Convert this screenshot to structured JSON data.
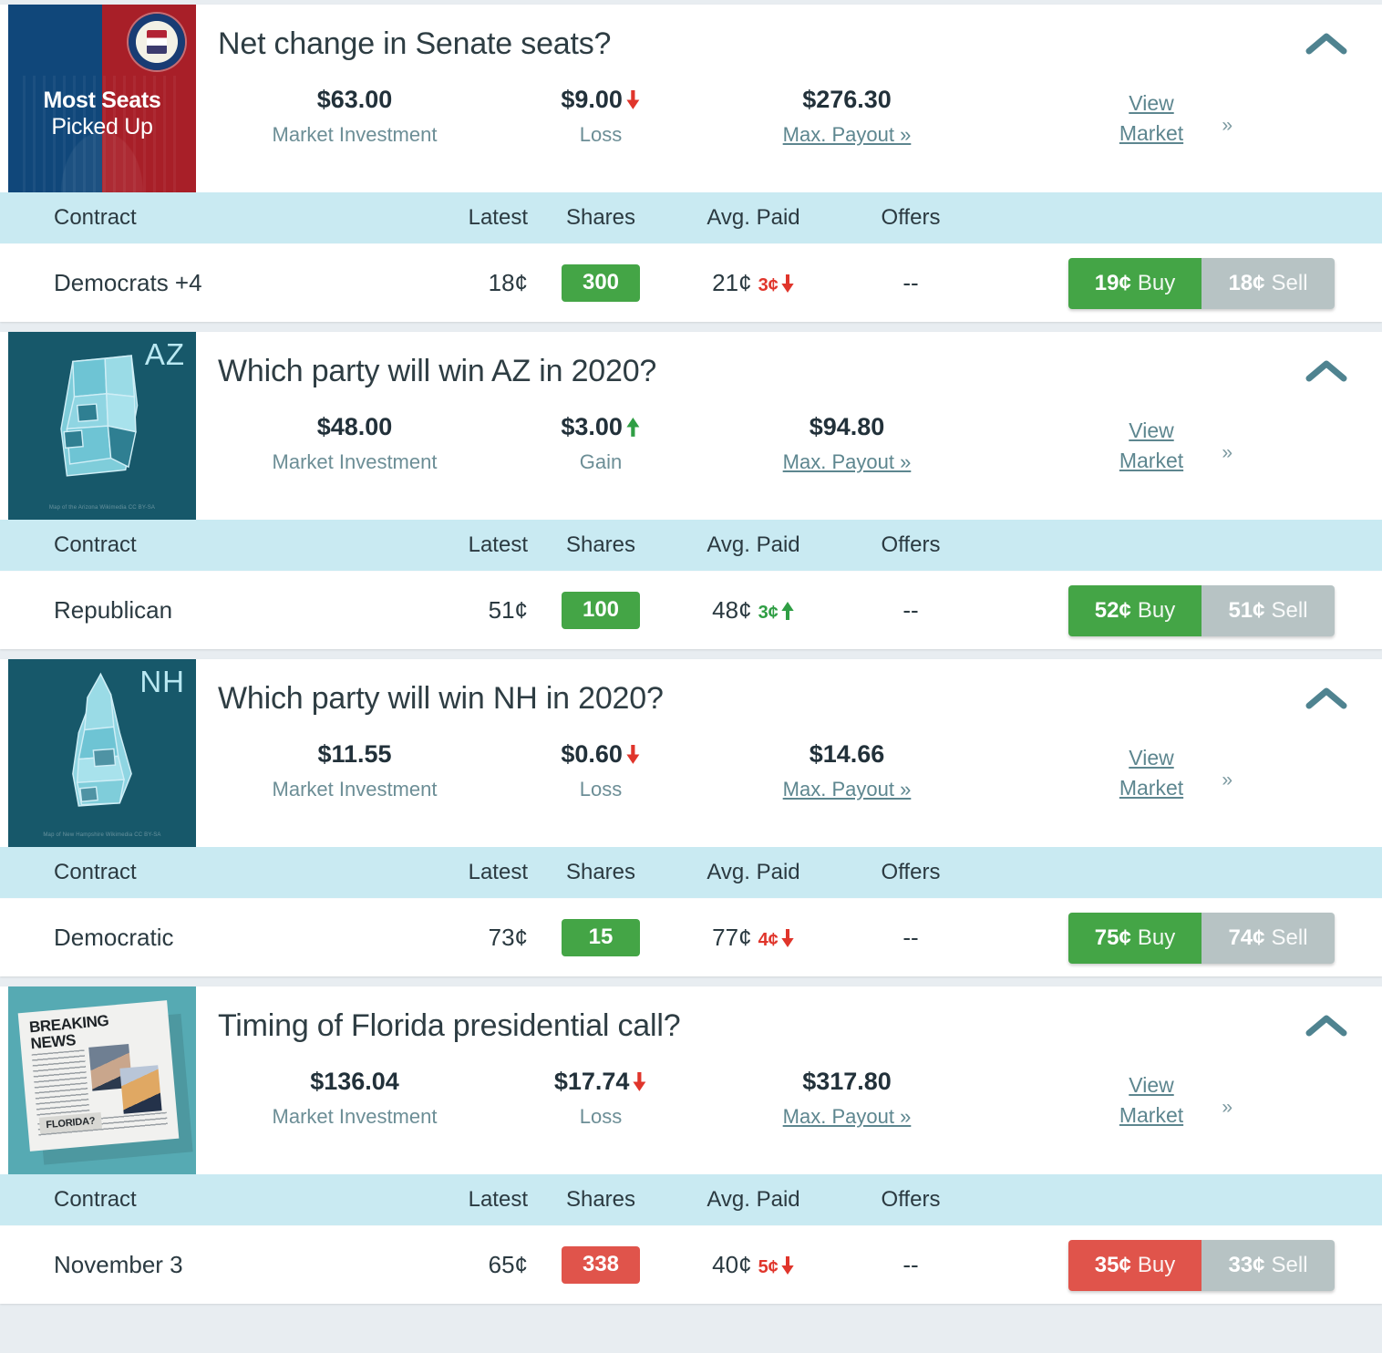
{
  "table_headers": {
    "contract": "Contract",
    "latest": "Latest",
    "shares": "Shares",
    "avg_paid": "Avg. Paid",
    "offers": "Offers"
  },
  "labels": {
    "market_investment": "Market Investment",
    "loss": "Loss",
    "gain": "Gain",
    "max_payout": "Max. Payout »",
    "view": "View",
    "market": "Market",
    "chevron_right": "»",
    "buy": "Buy",
    "sell": "Sell"
  },
  "colors": {
    "buy_green": "#44a546",
    "buy_red": "#e0544b",
    "sell_gray": "#b7c3c4",
    "badge_green": "#44a546",
    "badge_red": "#e0544b",
    "loss_red": "#e0352b",
    "gain_green": "#2f9e44",
    "table_header_bg": "#c9eaf2",
    "page_bg": "#e8edf1",
    "link_teal": "#5d868f"
  },
  "cards": [
    {
      "thumb": {
        "type": "senate-seal-thumbnail",
        "line1": "Most Seats",
        "line2": "Picked Up"
      },
      "title": "Net change in Senate seats?",
      "investment": "$63.00",
      "change_value": "$9.00",
      "change_type": "loss",
      "change_label": "Loss",
      "max_payout": "$276.30",
      "row": {
        "contract": "Democrats +4",
        "latest": "18¢",
        "shares": "300",
        "shares_color": "green",
        "avg_paid": "21¢",
        "avg_delta": "3¢",
        "avg_delta_dir": "down",
        "offers": "--",
        "buy_price": "19¢",
        "buy_color": "green",
        "sell_price": "18¢"
      }
    },
    {
      "thumb": {
        "type": "state-map-thumbnail",
        "state_code": "AZ",
        "credit": "Map of the Arizona Wikimedia CC BY-SA"
      },
      "title": "Which party will win AZ in 2020?",
      "investment": "$48.00",
      "change_value": "$3.00",
      "change_type": "gain",
      "change_label": "Gain",
      "max_payout": "$94.80",
      "row": {
        "contract": "Republican",
        "latest": "51¢",
        "shares": "100",
        "shares_color": "green",
        "avg_paid": "48¢",
        "avg_delta": "3¢",
        "avg_delta_dir": "up",
        "offers": "--",
        "buy_price": "52¢",
        "buy_color": "green",
        "sell_price": "51¢"
      }
    },
    {
      "thumb": {
        "type": "state-map-thumbnail",
        "state_code": "NH",
        "credit": "Map of New Hampshire Wikimedia CC BY-SA"
      },
      "title": "Which party will win NH in 2020?",
      "investment": "$11.55",
      "change_value": "$0.60",
      "change_type": "loss",
      "change_label": "Loss",
      "max_payout": "$14.66",
      "row": {
        "contract": "Democratic",
        "latest": "73¢",
        "shares": "15",
        "shares_color": "green",
        "avg_paid": "77¢",
        "avg_delta": "4¢",
        "avg_delta_dir": "down",
        "offers": "--",
        "buy_price": "75¢",
        "buy_color": "green",
        "sell_price": "74¢"
      }
    },
    {
      "thumb": {
        "type": "breaking-news-thumbnail",
        "headline": "BREAKING NEWS",
        "caption": "FLORIDA?"
      },
      "title": "Timing of Florida presidential call?",
      "investment": "$136.04",
      "change_value": "$17.74",
      "change_type": "loss",
      "change_label": "Loss",
      "max_payout": "$317.80",
      "row": {
        "contract": "November 3",
        "latest": "65¢",
        "shares": "338",
        "shares_color": "red",
        "avg_paid": "40¢",
        "avg_delta": "5¢",
        "avg_delta_dir": "down",
        "offers": "--",
        "buy_price": "35¢",
        "buy_color": "red",
        "sell_price": "33¢"
      }
    }
  ]
}
